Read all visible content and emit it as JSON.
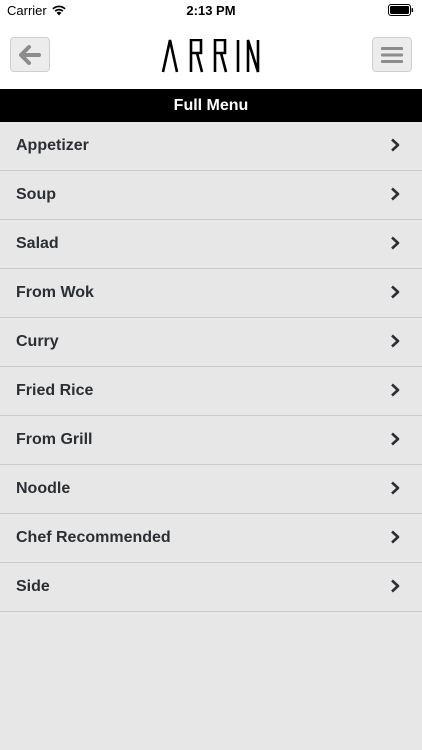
{
  "status_bar": {
    "carrier": "Carrier",
    "time": "2:13 PM"
  },
  "header": {
    "brand": "ARRIN",
    "back_icon": "arrow-left-icon",
    "menu_icon": "hamburger-icon"
  },
  "title_bar": {
    "title": "Full Menu"
  },
  "menu": {
    "items": [
      {
        "label": "Appetizer"
      },
      {
        "label": "Soup"
      },
      {
        "label": "Salad"
      },
      {
        "label": "From Wok"
      },
      {
        "label": "Curry"
      },
      {
        "label": "Fried Rice"
      },
      {
        "label": "From Grill"
      },
      {
        "label": "Noodle"
      },
      {
        "label": "Chef Recommended"
      },
      {
        "label": "Side"
      }
    ]
  },
  "colors": {
    "background": "#e7e7e7",
    "title_bar": "#000000",
    "header": "#ffffff",
    "text": "#2b2f33"
  }
}
